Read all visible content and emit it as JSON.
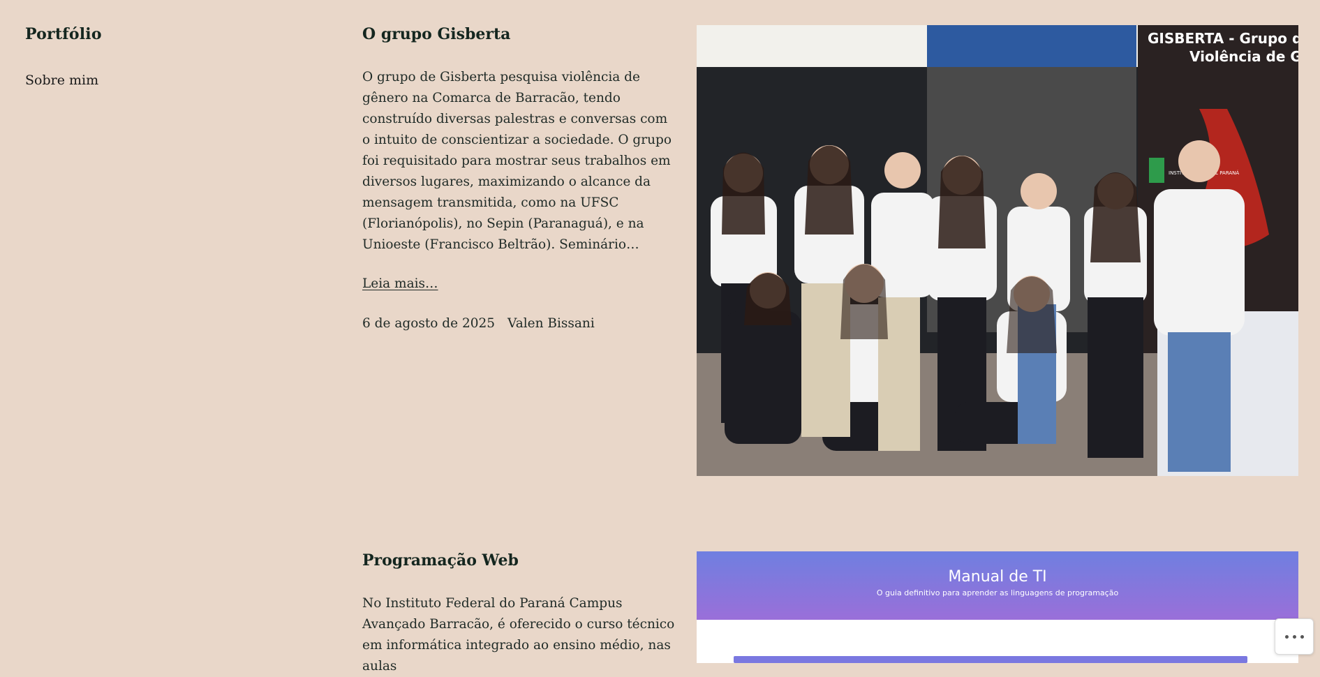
{
  "site": {
    "title": "Portfólio",
    "nav": [
      "Sobre mim"
    ]
  },
  "posts": [
    {
      "title": "O grupo Gisberta",
      "excerpt": "O grupo de Gisberta pesquisa violência de gênero na Comarca de Barracão, tendo construído diversas palestras e conversas com o intuito de conscientizar a sociedade. O grupo foi requisitado para mostrar seus trabalhos em diversos lugares, maximizando o alcance da mensagem transmitida, como na UFSC (Florianópolis), no Sepin (Paranaguá), e na Unioeste (Francisco Beltrão). Seminário…",
      "read_more": "Leia mais…",
      "date": "6 de agosto de 2025",
      "author": "Valen Bissani",
      "image": {
        "banner_line1": "GISBERTA - Grupo de Pes",
        "banner_line2": "Violência de Gêne",
        "badge_text": "INSTITUTO FEDERAL PARANÁ"
      }
    },
    {
      "title": "Programação Web",
      "excerpt": "No Instituto Federal do Paraná Campus Avançado Barracão, é oferecido o curso técnico em informática integrado ao ensino médio, nas aulas",
      "image": {
        "title": "Manual de TI",
        "subtitle": "O guia definitivo para aprender as linguagens de programação"
      }
    }
  ],
  "ui": {
    "more_button_icon": "ellipsis-icon"
  },
  "colors": {
    "background": "#e9d7c9",
    "heading": "#14261f",
    "preview_gradient_top": "#6f7fe0",
    "preview_gradient_bottom": "#9a6fd9"
  }
}
